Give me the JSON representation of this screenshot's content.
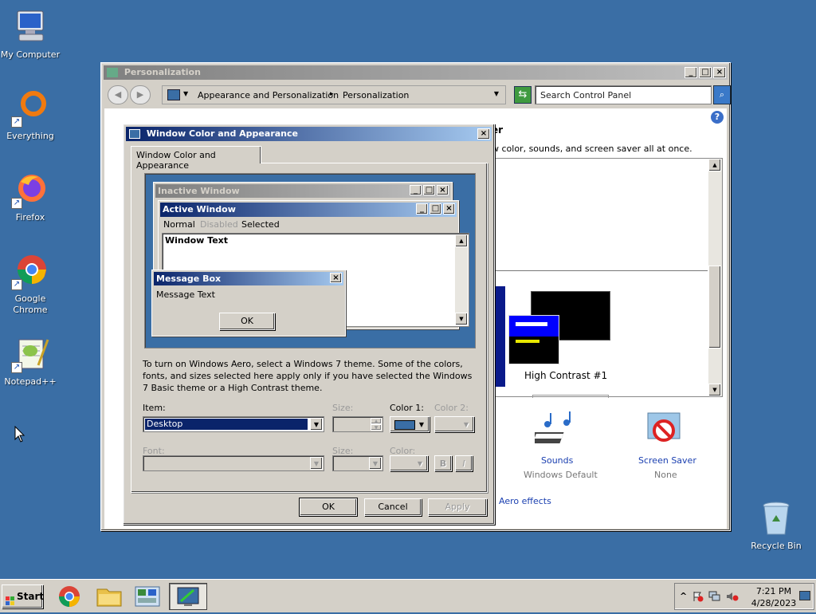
{
  "desktop": {
    "icons": [
      {
        "label": "My Computer"
      },
      {
        "label": "Everything"
      },
      {
        "label": "Firefox"
      },
      {
        "label": "Google Chrome"
      },
      {
        "label": "Notepad++"
      },
      {
        "label": "Recycle Bin"
      }
    ],
    "shortcut_glyph": "↗"
  },
  "personalization": {
    "title": "Personalization",
    "breadcrumb": [
      "Appearance and Personalization",
      "Personalization"
    ],
    "breadcrumb_sep": "▸",
    "search_placeholder": "Search Control Panel",
    "heading_fragment": "er",
    "desc_fragment": "w color, sounds, and screen saver all at once.",
    "theme_label": "High Contrast #1",
    "sounds": {
      "title": "Sounds",
      "subtitle": "Windows Default"
    },
    "screensaver": {
      "title": "Screen Saver",
      "subtitle": "None"
    },
    "aero_link": "Aero effects",
    "help_glyph": "?"
  },
  "dialog": {
    "title": "Window Color and Appearance",
    "tab": "Window Color and Appearance",
    "preview": {
      "inactive_title": "Inactive Window",
      "active_title": "Active Window",
      "menu": [
        "Normal",
        "Disabled",
        "Selected"
      ],
      "window_text": "Window Text",
      "msgbox_title": "Message Box",
      "msgbox_text": "Message Text",
      "msgbox_ok": "OK"
    },
    "info": "To turn on Windows Aero, select a Windows 7 theme.  Some of the colors, fonts, and sizes selected here apply only if you have selected the Windows 7 Basic theme or a High Contrast theme.",
    "item_label": "Item:",
    "item_value": "Desktop",
    "size_label": "Size:",
    "color1_label": "Color 1:",
    "color2_label": "Color 2:",
    "font_label": "Font:",
    "font_size_label": "Size:",
    "font_color_label": "Color:",
    "bold": "B",
    "italic": "I",
    "ok": "OK",
    "cancel": "Cancel",
    "apply": "Apply",
    "color1_swatch": "#3a6ea5"
  },
  "taskbar": {
    "start": "Start",
    "time": "7:21 PM",
    "date": "4/28/2023",
    "tray_expand": "^"
  },
  "colors": {
    "desktop": "#3a6ea5",
    "title_active": "#0a246a",
    "selection": "#0a246a",
    "link": "#1a3fb0"
  }
}
